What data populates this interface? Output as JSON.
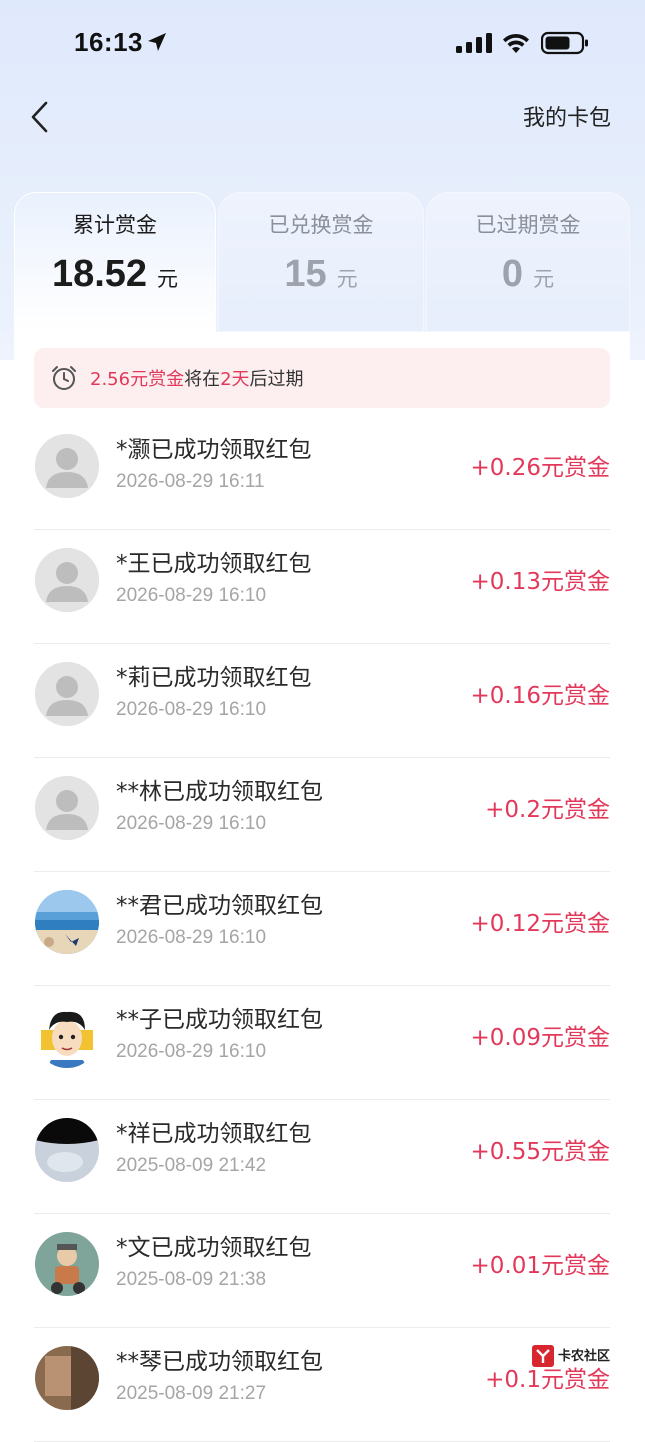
{
  "status_bar": {
    "time": "16:13"
  },
  "nav": {
    "right_label": "我的卡包"
  },
  "tabs": [
    {
      "label": "累计赏金",
      "amount": "18.52",
      "unit": "元",
      "active": true
    },
    {
      "label": "已兑换赏金",
      "amount": "15",
      "unit": "元",
      "active": false
    },
    {
      "label": "已过期赏金",
      "amount": "0",
      "unit": "元",
      "active": false
    }
  ],
  "notice": {
    "amount_text": "2.56元赏金",
    "mid_text": "将在",
    "days_text": "2天",
    "end_text": "后过期"
  },
  "records": [
    {
      "title": "*灏已成功领取红包",
      "time": "2026-08-29 16:11",
      "amount": "+0.26元赏金",
      "avatar": "default-avatar"
    },
    {
      "title": "*王已成功领取红包",
      "time": "2026-08-29 16:10",
      "amount": "+0.13元赏金",
      "avatar": "default-avatar"
    },
    {
      "title": "*莉已成功领取红包",
      "time": "2026-08-29 16:10",
      "amount": "+0.16元赏金",
      "avatar": "default-avatar"
    },
    {
      "title": "**林已成功领取红包",
      "time": "2026-08-29 16:10",
      "amount": "+0.2元赏金",
      "avatar": "default-avatar"
    },
    {
      "title": "**君已成功领取红包",
      "time": "2026-08-29 16:10",
      "amount": "+0.12元赏金",
      "avatar": "beach-photo-avatar"
    },
    {
      "title": "**子已成功领取红包",
      "time": "2026-08-29 16:10",
      "amount": "+0.09元赏金",
      "avatar": "cartoon-man-avatar"
    },
    {
      "title": "*祥已成功领取红包",
      "time": "2025-08-09 21:42",
      "amount": "+0.55元赏金",
      "avatar": "dark-photo-avatar"
    },
    {
      "title": "*文已成功领取红包",
      "time": "2025-08-09 21:38",
      "amount": "+0.01元赏金",
      "avatar": "scooter-photo-avatar"
    },
    {
      "title": "**琴已成功领取红包",
      "time": "2025-08-09 21:27",
      "amount": "+0.1元赏金",
      "avatar": "brown-photo-avatar"
    }
  ],
  "watermark": {
    "text": "卡农社区"
  },
  "colors": {
    "accent_red": "#e2395b",
    "background_blue": "#dfe9fc"
  }
}
